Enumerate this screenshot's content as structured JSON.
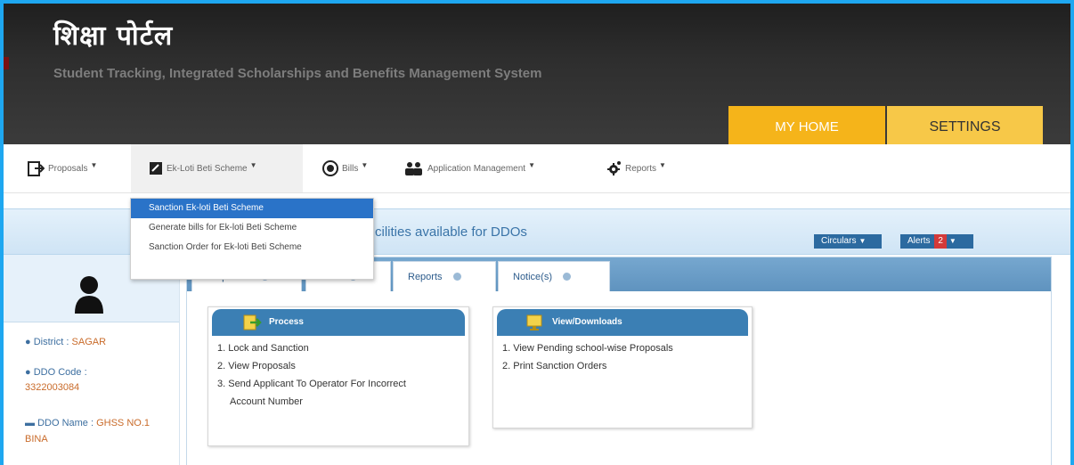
{
  "header": {
    "logo_title": "शिक्षा पोर्टल",
    "subtitle": "Student Tracking, Integrated Scholarships and Benefits Management System",
    "tabs": {
      "my_home": "MY HOME",
      "settings": "SETTINGS"
    }
  },
  "menubar": {
    "items": [
      {
        "label": "Proposals",
        "icon": "proposal-icon"
      },
      {
        "label": "Ek-Loti Beti Scheme",
        "icon": "scheme-icon"
      },
      {
        "label": "Bills",
        "icon": "bills-icon"
      },
      {
        "label": "Application Management",
        "icon": "users-icon"
      },
      {
        "label": "Reports",
        "icon": "gear-icon"
      }
    ]
  },
  "dropdown": {
    "items": [
      "Sanction Ek-loti Beti Scheme",
      "Generate bills for Ek-loti Beti Scheme",
      "Sanction Order for Ek-loti Beti Scheme"
    ],
    "selected_index": 0
  },
  "infobar": {
    "title": "cilities available for DDOs",
    "circulars": "Circulars",
    "alerts": "Alerts",
    "alerts_count": "2"
  },
  "sidebar": {
    "district_label": "District :",
    "district_value": "SAGAR",
    "ddo_code_label": "DDO Code :",
    "ddo_code_value": "3322003084",
    "ddo_name_label": "DDO Name :",
    "ddo_name_value": "GHSS NO.1 BINA"
  },
  "tabs": [
    {
      "label": "Proposals"
    },
    {
      "label": "Bills"
    },
    {
      "label": "Reports"
    },
    {
      "label": "Notice(s)"
    }
  ],
  "cards": {
    "process": {
      "title": "Process",
      "items": [
        "1. Lock and Sanction",
        "2. View Proposals",
        "3. Send Applicant To Operator For Incorrect",
        "Account Number"
      ]
    },
    "downloads": {
      "title": "View/Downloads",
      "items": [
        "1. View Pending school-wise Proposals",
        "2. Print Sanction Orders"
      ]
    }
  },
  "colors": {
    "frame_border": "#1ea7f0",
    "my_home_tab": "#f5b41a",
    "settings_tab": "#f7c848",
    "dropdown_selected": "#2a73c8",
    "card_header": "#3b7fb4",
    "alert_badge": "#d43a3a"
  }
}
